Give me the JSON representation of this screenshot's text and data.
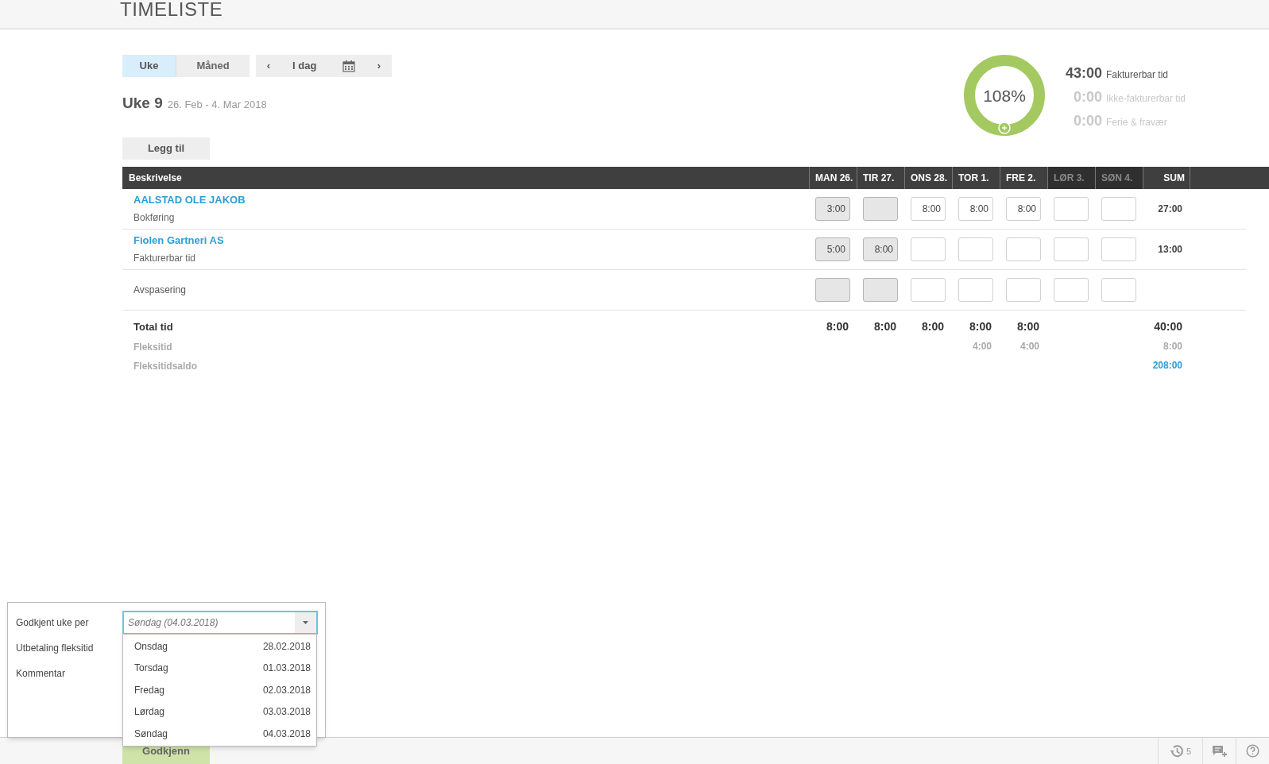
{
  "header": {
    "title": "TIMELISTE"
  },
  "view_tabs": [
    {
      "label": "Uke",
      "selected": true
    },
    {
      "label": "Måned",
      "selected": false
    }
  ],
  "date_nav": {
    "prev": "‹",
    "today": "I dag",
    "next": "›"
  },
  "week": {
    "title": "Uke 9",
    "range": "26. Feb - 4. Mar 2018"
  },
  "add_button": "Legg til",
  "summary": {
    "percent": "108%",
    "lines": [
      {
        "value": "43:00",
        "label": "Fakturerbar tid",
        "muted": false
      },
      {
        "value": "0:00",
        "label": "Ikke-fakturerbar tid",
        "muted": true
      },
      {
        "value": "0:00",
        "label": "Ferie & fravær",
        "muted": true
      }
    ]
  },
  "table": {
    "columns": [
      {
        "label": "Beskrivelse",
        "kind": "description",
        "weekend": false
      },
      {
        "label": "MAN 26.",
        "kind": "day",
        "weekend": false
      },
      {
        "label": "TIR 27.",
        "kind": "day",
        "weekend": false
      },
      {
        "label": "ONS 28.",
        "kind": "day",
        "weekend": false
      },
      {
        "label": "TOR 1.",
        "kind": "day",
        "weekend": false
      },
      {
        "label": "FRE 2.",
        "kind": "day",
        "weekend": false
      },
      {
        "label": "LØR 3.",
        "kind": "day",
        "weekend": true
      },
      {
        "label": "SØN 4.",
        "kind": "day",
        "weekend": true
      },
      {
        "label": "SUM",
        "kind": "sum",
        "weekend": false
      }
    ],
    "rows": [
      {
        "kind": "project",
        "title": "AALSTAD OLE JAKOB",
        "subtitle": "Bokføring",
        "sum": "27:00",
        "days": [
          {
            "value": "3:00",
            "locked": true
          },
          {
            "locked": true
          },
          {
            "value": "8:00",
            "locked": false
          },
          {
            "value": "8:00",
            "locked": false
          },
          {
            "value": "8:00",
            "locked": false
          },
          {
            "locked": false
          },
          {
            "locked": false
          }
        ]
      },
      {
        "kind": "project",
        "title": "Fiolen Gartneri AS",
        "subtitle": "Fakturerbar tid",
        "sum": "13:00",
        "days": [
          {
            "value": "5:00",
            "locked": true
          },
          {
            "value": "8:00",
            "locked": true
          },
          {
            "locked": false
          },
          {
            "locked": false
          },
          {
            "locked": false
          },
          {
            "locked": false
          },
          {
            "locked": false
          }
        ]
      },
      {
        "kind": "plain",
        "title": "Avspasering",
        "days": [
          {
            "locked": true
          },
          {
            "locked": true
          },
          {
            "locked": false
          },
          {
            "locked": false
          },
          {
            "locked": false
          },
          {
            "locked": false
          },
          {
            "locked": false
          }
        ]
      }
    ],
    "totals": [
      {
        "kind": "total",
        "label": "Total tid",
        "days": [
          {
            "kind": "time",
            "value": "8:00"
          },
          {
            "kind": "time",
            "value": "8:00"
          },
          {
            "kind": "time",
            "value": "8:00"
          },
          {
            "kind": "time",
            "value": "8:00"
          },
          {
            "kind": "time",
            "value": "8:00"
          },
          {
            "kind": "blank"
          },
          {
            "kind": "blank"
          }
        ],
        "sum": "40:00"
      },
      {
        "kind": "flex",
        "label": "Fleksitid",
        "days": [
          {
            "kind": "blank"
          },
          {
            "kind": "blank"
          },
          {
            "kind": "blank"
          },
          {
            "kind": "time",
            "value": "4:00"
          },
          {
            "kind": "time",
            "value": "4:00"
          },
          {
            "kind": "blank"
          },
          {
            "kind": "blank"
          }
        ],
        "sum": "8:00"
      },
      {
        "kind": "balance",
        "label": "Fleksitidsaldo",
        "sum": "208:00"
      }
    ]
  },
  "approval_popup": {
    "fields": [
      {
        "label": "Godkjent uke per"
      },
      {
        "label": "Utbetaling fleksitid"
      },
      {
        "label": "Kommentar"
      }
    ],
    "select": {
      "placeholder": "Søndag (04.03.2018)"
    },
    "options": [
      {
        "day": "Onsdag",
        "date": "28.02.2018",
        "selected": false
      },
      {
        "day": "Torsdag",
        "date": "01.03.2018",
        "selected": false
      },
      {
        "day": "Fredag",
        "date": "02.03.2018",
        "selected": false
      },
      {
        "day": "Lørdag",
        "date": "03.03.2018",
        "selected": false
      },
      {
        "day": "Søndag",
        "date": "04.03.2018",
        "selected": false
      }
    ]
  },
  "footer": {
    "approve_button": "Godkjenn",
    "history_count": "5"
  }
}
